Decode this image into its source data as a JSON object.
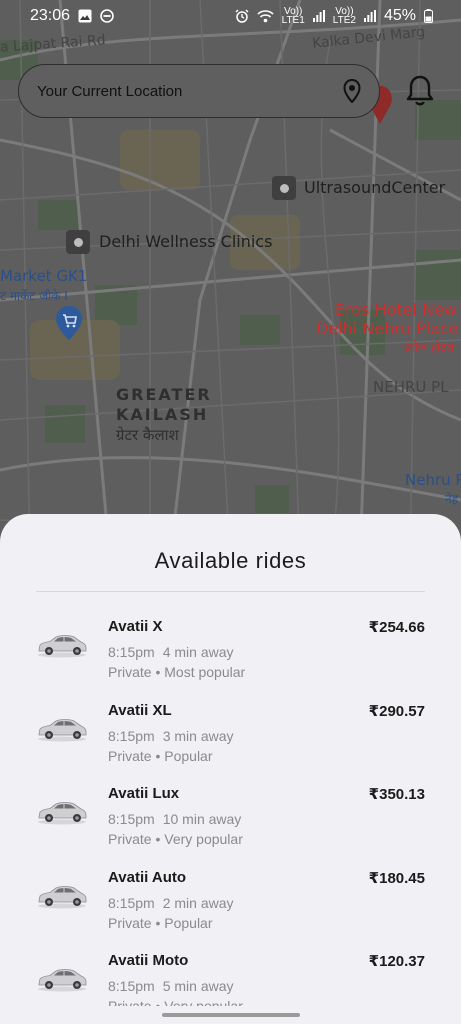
{
  "status_bar": {
    "time": "23:06",
    "left_icons": [
      "gallery-icon",
      "do-not-disturb-icon"
    ],
    "right_icons": [
      "alarm-icon",
      "wifi-icon",
      "signal-icon"
    ],
    "sim1_label_top": "Vo))",
    "sim1_label_bottom": "LTE1",
    "sim2_label_top": "Vo))",
    "sim2_label_bottom": "LTE2",
    "battery": "45%"
  },
  "map": {
    "labels": {
      "lajpat": "a Lajpat Rai Rd",
      "kalka": "Kalka Devi Marg",
      "ultrasound": "UltrasoundCenter",
      "wellness": "Delhi Wellness Clinics",
      "market": "Market GK1",
      "market_hi": "ट मार्केट जीके I",
      "eros_1": "Eros Hotel New",
      "eros_2": "Delhi Nehru Place",
      "eros_hi": "इरोज होटल",
      "greater": "GREATER",
      "kailash": "KAILASH",
      "kailash_hi": "ग्रेटर कैलाश",
      "nehru": "NEHRU PL",
      "nehru_2": "Nehru P",
      "nehru_hi": "नेह"
    }
  },
  "location": {
    "text": "Your Current Location",
    "icon": "location-pin-icon"
  },
  "notification_icon": "bell-icon",
  "sheet": {
    "title": "Available rides",
    "rides": [
      {
        "name": "Avatii X",
        "time": "8:15pm",
        "away": "4 min away",
        "tags": "Private • Most popular",
        "price": "₹254.66"
      },
      {
        "name": "Avatii XL",
        "time": "8:15pm",
        "away": "3 min away",
        "tags": "Private • Popular",
        "price": "₹290.57"
      },
      {
        "name": "Avatii Lux",
        "time": "8:15pm",
        "away": "10 min away",
        "tags": "Private • Very popular",
        "price": "₹350.13"
      },
      {
        "name": "Avatii Auto",
        "time": "8:15pm",
        "away": "2 min away",
        "tags": "Private • Popular",
        "price": "₹180.45"
      },
      {
        "name": "Avatii Moto",
        "time": "8:15pm",
        "away": "5 min away",
        "tags": "Private • Very popular",
        "price": "₹120.37"
      }
    ]
  },
  "colors": {
    "sheet_bg": "#f1f0f4",
    "map_overlay": "#5e5e5e",
    "secondary_text": "#8a8a8f",
    "map_pin_red": "#c8302f"
  }
}
